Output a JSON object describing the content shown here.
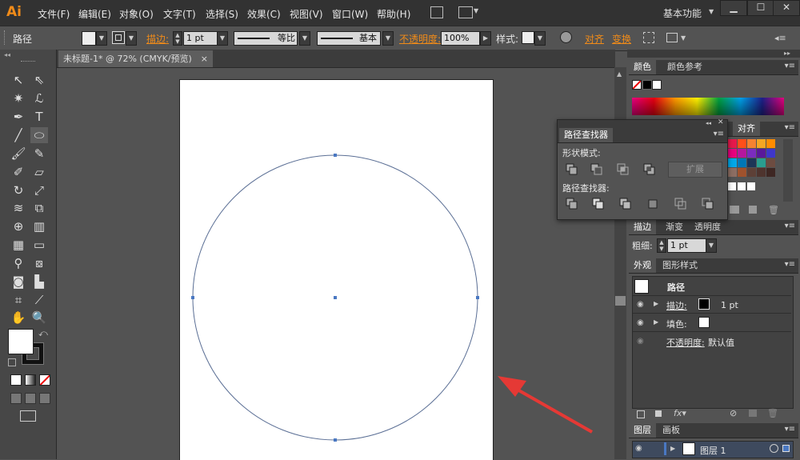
{
  "app": {
    "logo": "Ai"
  },
  "menu": {
    "items": [
      "文件(F)",
      "编辑(E)",
      "对象(O)",
      "文字(T)",
      "选择(S)",
      "效果(C)",
      "视图(V)",
      "窗口(W)",
      "帮助(H)"
    ],
    "workspace": "基本功能"
  },
  "control": {
    "selection": "路径",
    "stroke_label": "描边:",
    "stroke_weight": "1 pt",
    "stroke_profile": "等比",
    "brush": "基本",
    "opacity_label": "不透明度:",
    "opacity_value": "100%",
    "style_label": "样式:",
    "align_label": "对齐",
    "transform_label": "变换"
  },
  "document": {
    "tab_title": "未标题-1* @ 72% (CMYK/预览)",
    "close_glyph": "×"
  },
  "panels": {
    "color": {
      "tab": "颜色",
      "tab2": "颜色参考"
    },
    "swatches": {
      "tab_align": "对齐",
      "colors": [
        "#e6194b",
        "#ff4f1a",
        "#f58231",
        "#f5a623",
        "#ff8c00",
        "#e6007e",
        "#b5179e",
        "#7b2cbf",
        "#5a189a",
        "#3f37c9",
        "#00a8e8",
        "#0077b6",
        "#1d3557",
        "#2a9d8f",
        "#6d4c41",
        "#8d6e63",
        "#a0522d",
        "#5d4037",
        "#4e342e",
        "#3e2723"
      ]
    },
    "pathfinder": {
      "title": "路径查找器",
      "shape_modes": "形状模式:",
      "expand": "扩展",
      "pathfinders": "路径查找器:"
    },
    "stroke": {
      "tab": "描边",
      "tab2": "渐变",
      "tab3": "透明度",
      "weight_label": "粗细:",
      "weight_value": "1 pt"
    },
    "appearance": {
      "tab": "外观",
      "tab2": "图形样式",
      "object": "路径",
      "stroke_label": "描边:",
      "stroke_value": "1 pt",
      "fill_label": "填色:",
      "opacity_label": "不透明度:",
      "opacity_value": "默认值"
    },
    "layers": {
      "tab": "图层",
      "tab2": "画板",
      "layer_name": "图层 1"
    }
  },
  "colors": {
    "accent_orange": "#f08b19",
    "selection_blue": "#4a78c2",
    "arrow_red": "#e53935"
  }
}
